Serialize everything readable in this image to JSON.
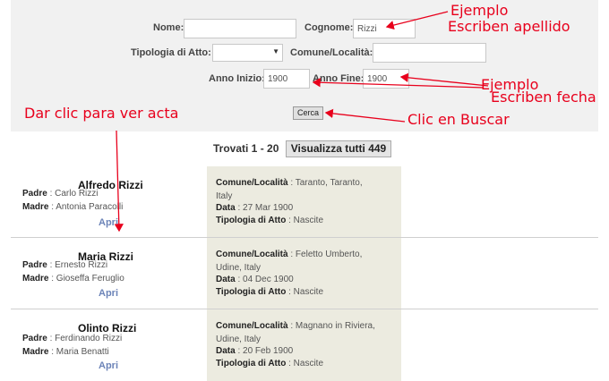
{
  "form": {
    "nome_label": "Nome",
    "nome_value": "",
    "cognome_label": "Cognome",
    "cognome_value": "Rizzi",
    "tipologia_label": "Tipologia di Atto",
    "tipologia_value": "",
    "comune_label": "Comune/Località",
    "comune_value": "",
    "anno_inizio_label": "Anno Inizio",
    "anno_inizio_value": "1900",
    "anno_fine_label": "Anno Fine",
    "anno_fine_value": "1900",
    "cerca_label": "Cerca"
  },
  "annotations": {
    "ejemplo1": "Ejemplo",
    "apellido": "Escriben apellido",
    "ejemplo2": "Ejemplo",
    "fecha": "Escriben fecha",
    "buscar": "Clic en Buscar",
    "ver_acta": "Dar clic para ver acta",
    "color": "#e8001c"
  },
  "results": {
    "trovati_label": "Trovati 1 - 20",
    "show_all_label": "Visualizza tutti 449",
    "padre_label": "Padre",
    "madre_label": "Madre",
    "apri_label": "Apri",
    "comune_label": "Comune/Località",
    "data_label": "Data",
    "tipologia_label": "Tipologia di Atto",
    "items": [
      {
        "name": "Alfredo Rizzi",
        "padre": "Carlo Rizzi",
        "madre": "Antonia Paracolli",
        "comune_line1": "Taranto, Taranto,",
        "comune_line2": "Italy",
        "data": "27 Mar 1900",
        "tipologia": "Nascite"
      },
      {
        "name": "Maria Rizzi",
        "padre": "Ernesto Rizzi",
        "madre": "Gioseffa Feruglio",
        "comune_line1": "Feletto Umberto,",
        "comune_line2": "Udine, Italy",
        "data": "04 Dec 1900",
        "tipologia": "Nascite"
      },
      {
        "name": "Olinto Rizzi",
        "padre": "Ferdinando Rizzi",
        "madre": "Maria Benatti",
        "comune_line1": "Magnano in Riviera,",
        "comune_line2": "Udine, Italy",
        "data": "20 Feb 1900",
        "tipologia": "Nascite"
      }
    ]
  }
}
